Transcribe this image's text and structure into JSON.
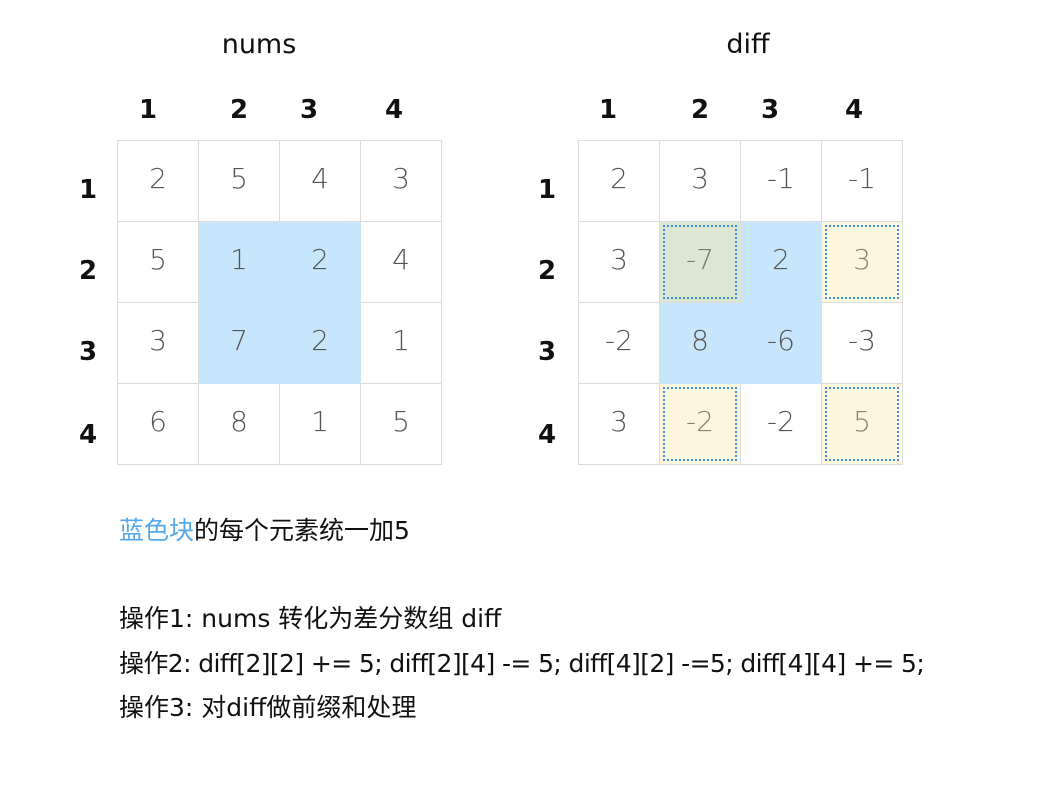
{
  "left_grid": {
    "title": "nums",
    "col_headers": [
      "1",
      "2",
      "3",
      "4"
    ],
    "row_headers": [
      "1",
      "2",
      "3",
      "4"
    ],
    "cells": [
      [
        "2",
        "5",
        "4",
        "3"
      ],
      [
        "5",
        "1",
        "2",
        "4"
      ],
      [
        "3",
        "7",
        "2",
        "1"
      ],
      [
        "6",
        "8",
        "1",
        "5"
      ]
    ],
    "highlight_blue": [
      [
        1,
        1
      ],
      [
        1,
        2
      ],
      [
        2,
        1
      ],
      [
        2,
        2
      ]
    ]
  },
  "right_grid": {
    "title": "diff",
    "col_headers": [
      "1",
      "2",
      "3",
      "4"
    ],
    "row_headers": [
      "1",
      "2",
      "3",
      "4"
    ],
    "cells": [
      [
        "2",
        "3",
        "-1",
        "-1"
      ],
      [
        "3",
        "-7",
        "2",
        "3"
      ],
      [
        "-2",
        "8",
        "-6",
        "-3"
      ],
      [
        "3",
        "-2",
        "-2",
        "5"
      ]
    ],
    "highlight_blue": [
      [
        1,
        2
      ],
      [
        2,
        1
      ],
      [
        2,
        2
      ]
    ],
    "highlight_green_dotted": [
      [
        1,
        1
      ]
    ],
    "highlight_yellow_dotted": [
      [
        1,
        3
      ],
      [
        3,
        1
      ],
      [
        3,
        3
      ]
    ]
  },
  "colors": {
    "blue_block": "#c8e6fb",
    "green_block": "#dce7d3",
    "yellow_block": "#fbf6dd",
    "dotted_border": "#3d8fe6",
    "blue_text": "#55a7ea",
    "grid_line": "#dcdcdc"
  },
  "notes": {
    "caption_highlight": "蓝色块",
    "caption_rest": "的每个元素统一加5",
    "op1": "操作1:  nums 转化为差分数组 diff",
    "op2": "操作2:  diff[2][2] += 5;  diff[2][4] -= 5; diff[4][2] -=5; diff[4][4] += 5;",
    "op3": "操作3:  对diff做前缀和处理"
  }
}
